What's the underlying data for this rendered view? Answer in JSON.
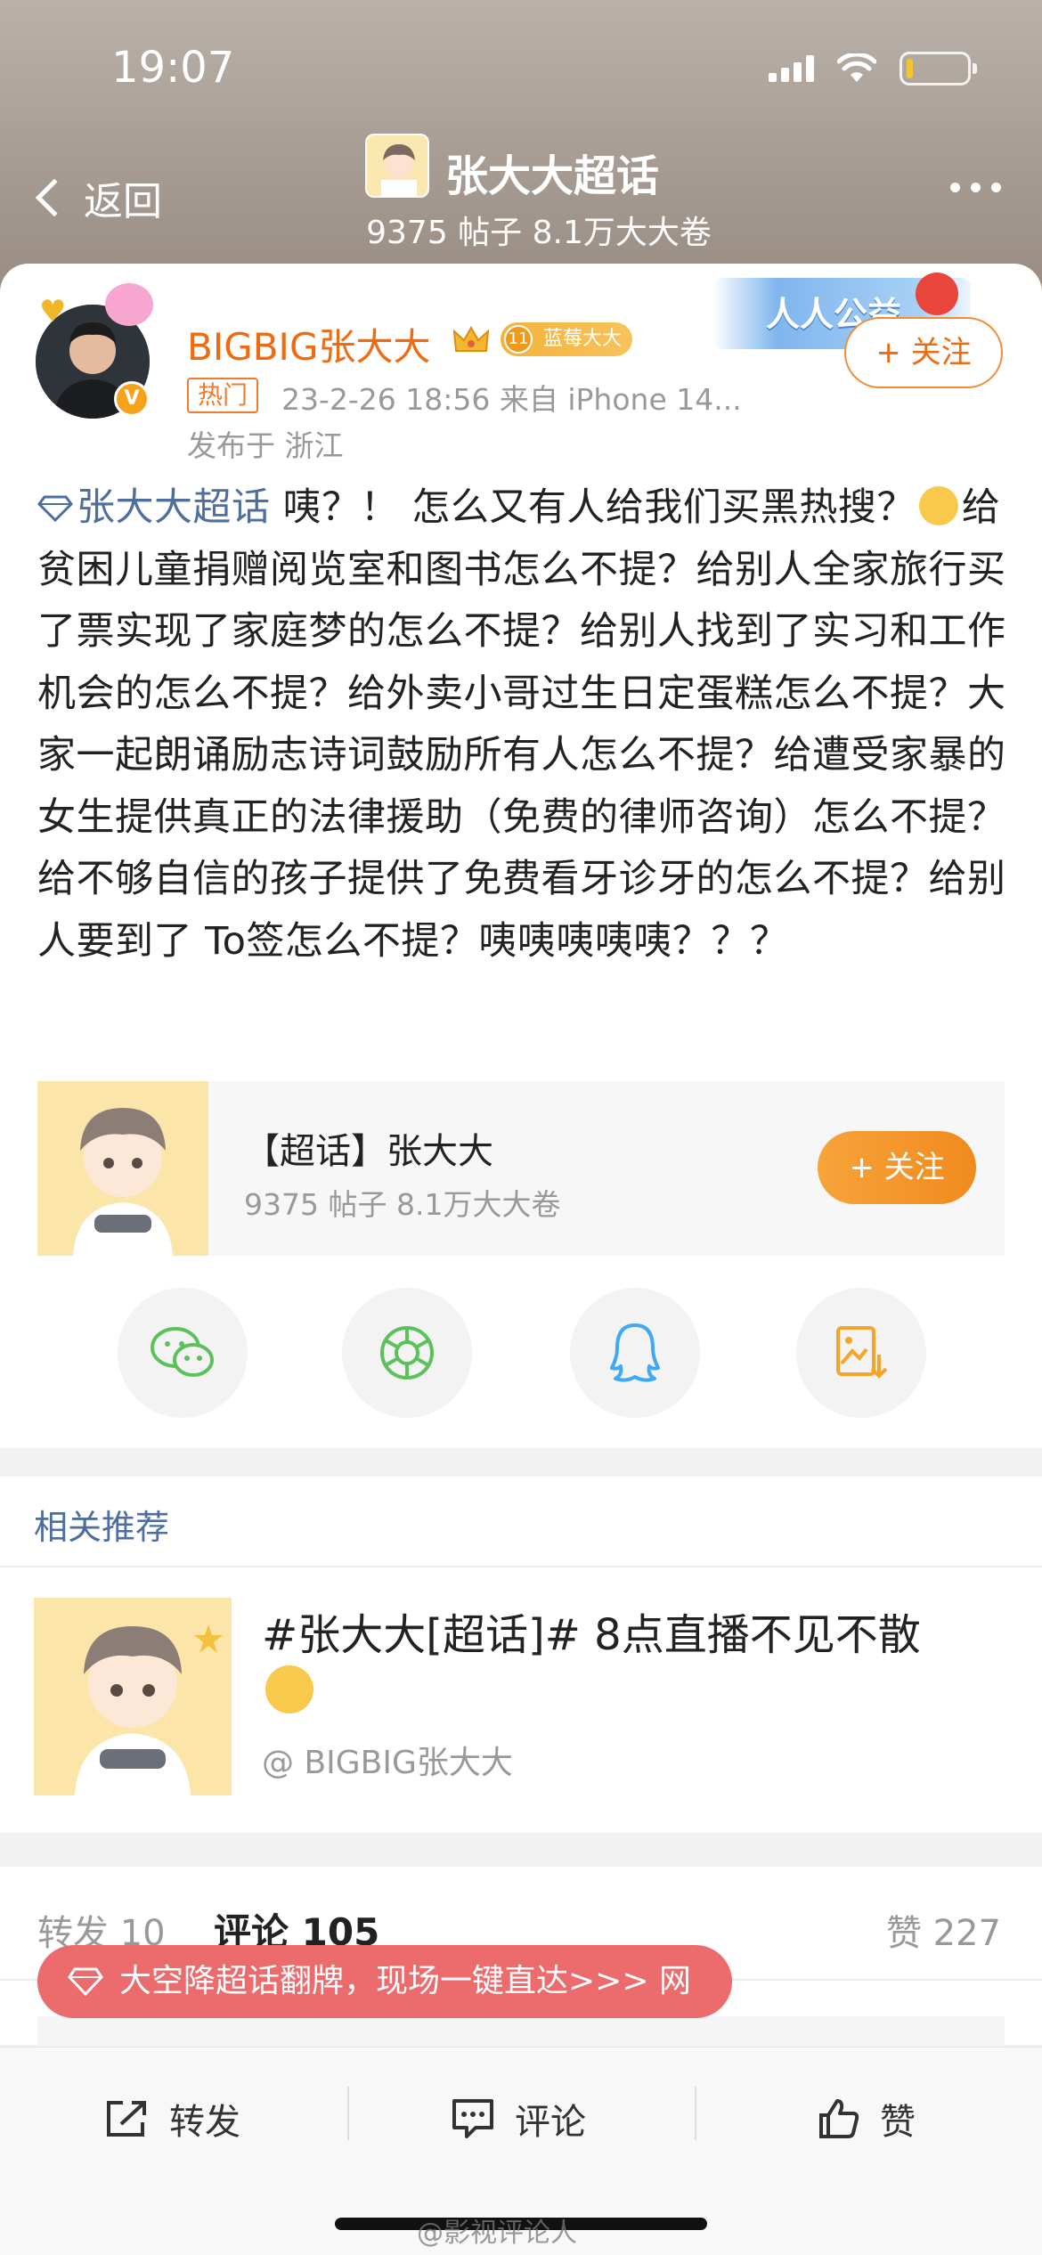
{
  "status_bar": {
    "time": "19:07"
  },
  "header": {
    "back_label": "返回",
    "topic_title": "张大大超话",
    "topic_stats": "9375 帖子 8.1万大大卷"
  },
  "post": {
    "author_name": "BIGBIG张大大",
    "fan_badge": "蓝莓大大",
    "fan_level": "11",
    "hot_tag": "热门",
    "meta": "23-2-26 18:56  来自 iPhone 14...",
    "location": "发布于 浙江",
    "charity_text": "人人公益",
    "follow_label": "+ 关注",
    "topic_link": "张大大超话",
    "text_a": " 咦？！ 怎么又有人给我们买黑热搜？",
    "text_b": "给贫困儿童捐赠阅览室和图书怎么不提？给别人全家旅行买了票实现了家庭梦的怎么不提？给别人找到了实习和工作机会的怎么不提？给外卖小哥过生日定蛋糕怎么不提？大家一起朗诵励志诗词鼓励所有人怎么不提？给遭受家暴的女生提供真正的法律援助（免费的律师咨询）怎么不提？给不够自信的孩子提供了免费看牙诊牙的怎么不提？给别人要到了 To签怎么不提？咦咦咦咦咦？？？"
  },
  "topic_card": {
    "title": "【超话】张大大",
    "stats": "9375 帖子 8.1万大大卷",
    "follow_label": "+ 关注"
  },
  "share_icons": [
    "wechat-icon",
    "moments-icon",
    "qq-icon",
    "save-image-icon"
  ],
  "related": {
    "heading": "相关推荐",
    "title": "#张大大[超话]# 8点直播不见不散",
    "user": "@ BIGBIG张大大"
  },
  "stats": {
    "repost": "转发 10",
    "comment": "评论 105",
    "like": "赞 227"
  },
  "toast": {
    "text": "大空降超话翻牌，现场一键直达>>> 网"
  },
  "bottom_bar": {
    "repost": "转发",
    "comment": "评论",
    "like": "赞"
  },
  "watermark": "@影视评论人",
  "colors": {
    "accent": "#f06a12",
    "link": "#4e6f9e",
    "toast": "#ec6b6d"
  }
}
